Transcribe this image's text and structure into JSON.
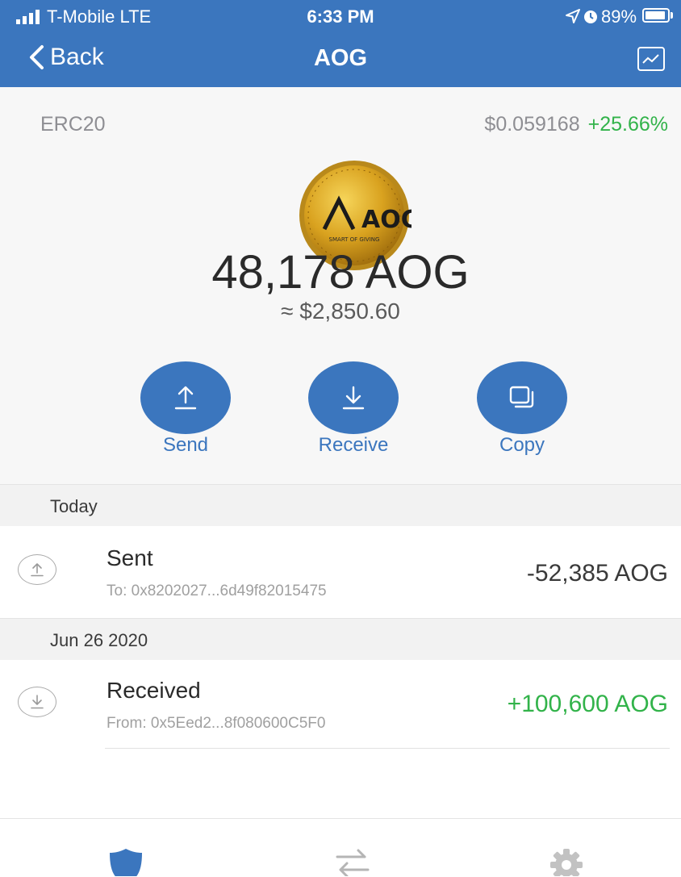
{
  "status_bar": {
    "carrier": "T-Mobile  LTE",
    "time": "6:33 PM",
    "battery": "89%"
  },
  "nav": {
    "back_label": "Back",
    "title": "AOG",
    "chart_icon": "line-chart-icon"
  },
  "token": {
    "standard": "ERC20",
    "price": "$0.059168",
    "change": "+25.66%",
    "change_color": "#32b34a",
    "logo_text": "AOG",
    "logo_subtext": "SMART OF GIVING",
    "balance": "48,178 AOG",
    "fiat_value": "≈ $2,850.60"
  },
  "actions": [
    {
      "label": "Send",
      "icon": "upload-icon"
    },
    {
      "label": "Receive",
      "icon": "download-icon"
    },
    {
      "label": "Copy",
      "icon": "copy-icon"
    }
  ],
  "sections": [
    {
      "date": "Today",
      "transactions": [
        {
          "type": "Sent",
          "address": "To: 0x8202027...6d49f82015475",
          "amount": "-52,385 AOG",
          "amount_color": "#3a3a3a",
          "icon": "sent-arrow-icon"
        }
      ]
    },
    {
      "date": "Jun 26 2020",
      "transactions": [
        {
          "type": "Received",
          "address": "From: 0x5Eed2...8f080600C5F0",
          "amount": "+100,600 AOG",
          "amount_color": "#32b34a",
          "icon": "received-arrow-icon"
        }
      ]
    }
  ],
  "tabbar": {
    "tabs": [
      {
        "name": "wallet",
        "icon": "shield-icon",
        "active": true
      },
      {
        "name": "dapps",
        "icon": "swap-arrows-icon",
        "active": false
      },
      {
        "name": "settings",
        "icon": "gear-icon",
        "active": false
      }
    ],
    "accent": "#3b76be"
  }
}
